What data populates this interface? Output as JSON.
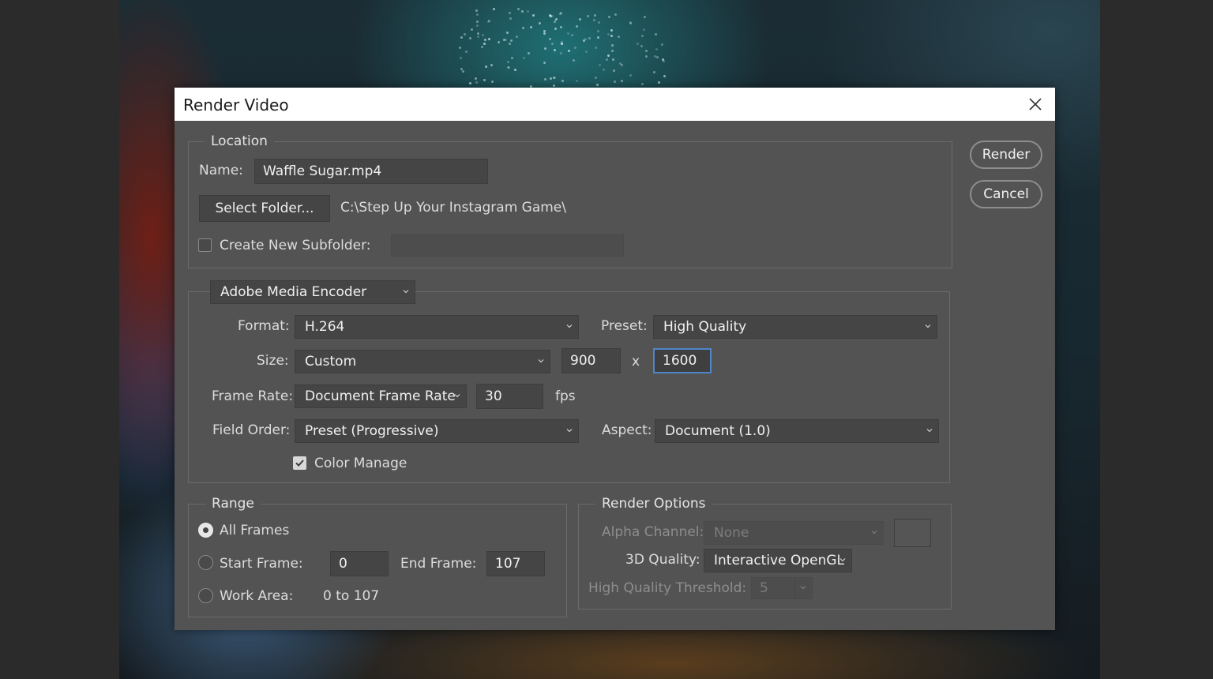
{
  "dialog": {
    "title": "Render Video",
    "close_icon": "close-icon",
    "render_label": "Render",
    "cancel_label": "Cancel"
  },
  "location": {
    "legend": "Location",
    "name_label": "Name:",
    "name_value": "Waffle Sugar.mp4",
    "select_folder_label": "Select Folder...",
    "folder_path": "C:\\Step Up Your Instagram Game\\",
    "subfolder_label": "Create New Subfolder:",
    "subfolder_checked": false,
    "subfolder_value": ""
  },
  "encoder": {
    "selected": "Adobe Media Encoder",
    "format_label": "Format:",
    "format_value": "H.264",
    "preset_label": "Preset:",
    "preset_value": "High Quality",
    "size_label": "Size:",
    "size_value": "Custom",
    "width_value": "900",
    "times": "x",
    "height_value": "1600",
    "frame_rate_label": "Frame Rate:",
    "frame_rate_value": "Document Frame Rate",
    "fps_value": "30",
    "fps_label": "fps",
    "field_order_label": "Field Order:",
    "field_order_value": "Preset (Progressive)",
    "aspect_label": "Aspect:",
    "aspect_value": "Document (1.0)",
    "color_manage_label": "Color Manage",
    "color_manage_checked": true
  },
  "range": {
    "legend": "Range",
    "all_frames_label": "All Frames",
    "start_frame_label": "Start Frame:",
    "start_frame_value": "0",
    "end_frame_label": "End Frame:",
    "end_frame_value": "107",
    "work_area_label": "Work Area:",
    "work_area_value": "0 to 107",
    "selected": "All Frames"
  },
  "render_options": {
    "legend": "Render Options",
    "alpha_label": "Alpha Channel:",
    "alpha_value": "None",
    "quality_3d_label": "3D Quality:",
    "quality_3d_value": "Interactive OpenGL",
    "threshold_label": "High Quality Threshold:",
    "threshold_value": "5"
  },
  "colors": {
    "dialog_bg": "#535353",
    "field_bg": "#454545",
    "focus_border": "#4e86c9",
    "titlebar_bg": "#ffffff"
  }
}
